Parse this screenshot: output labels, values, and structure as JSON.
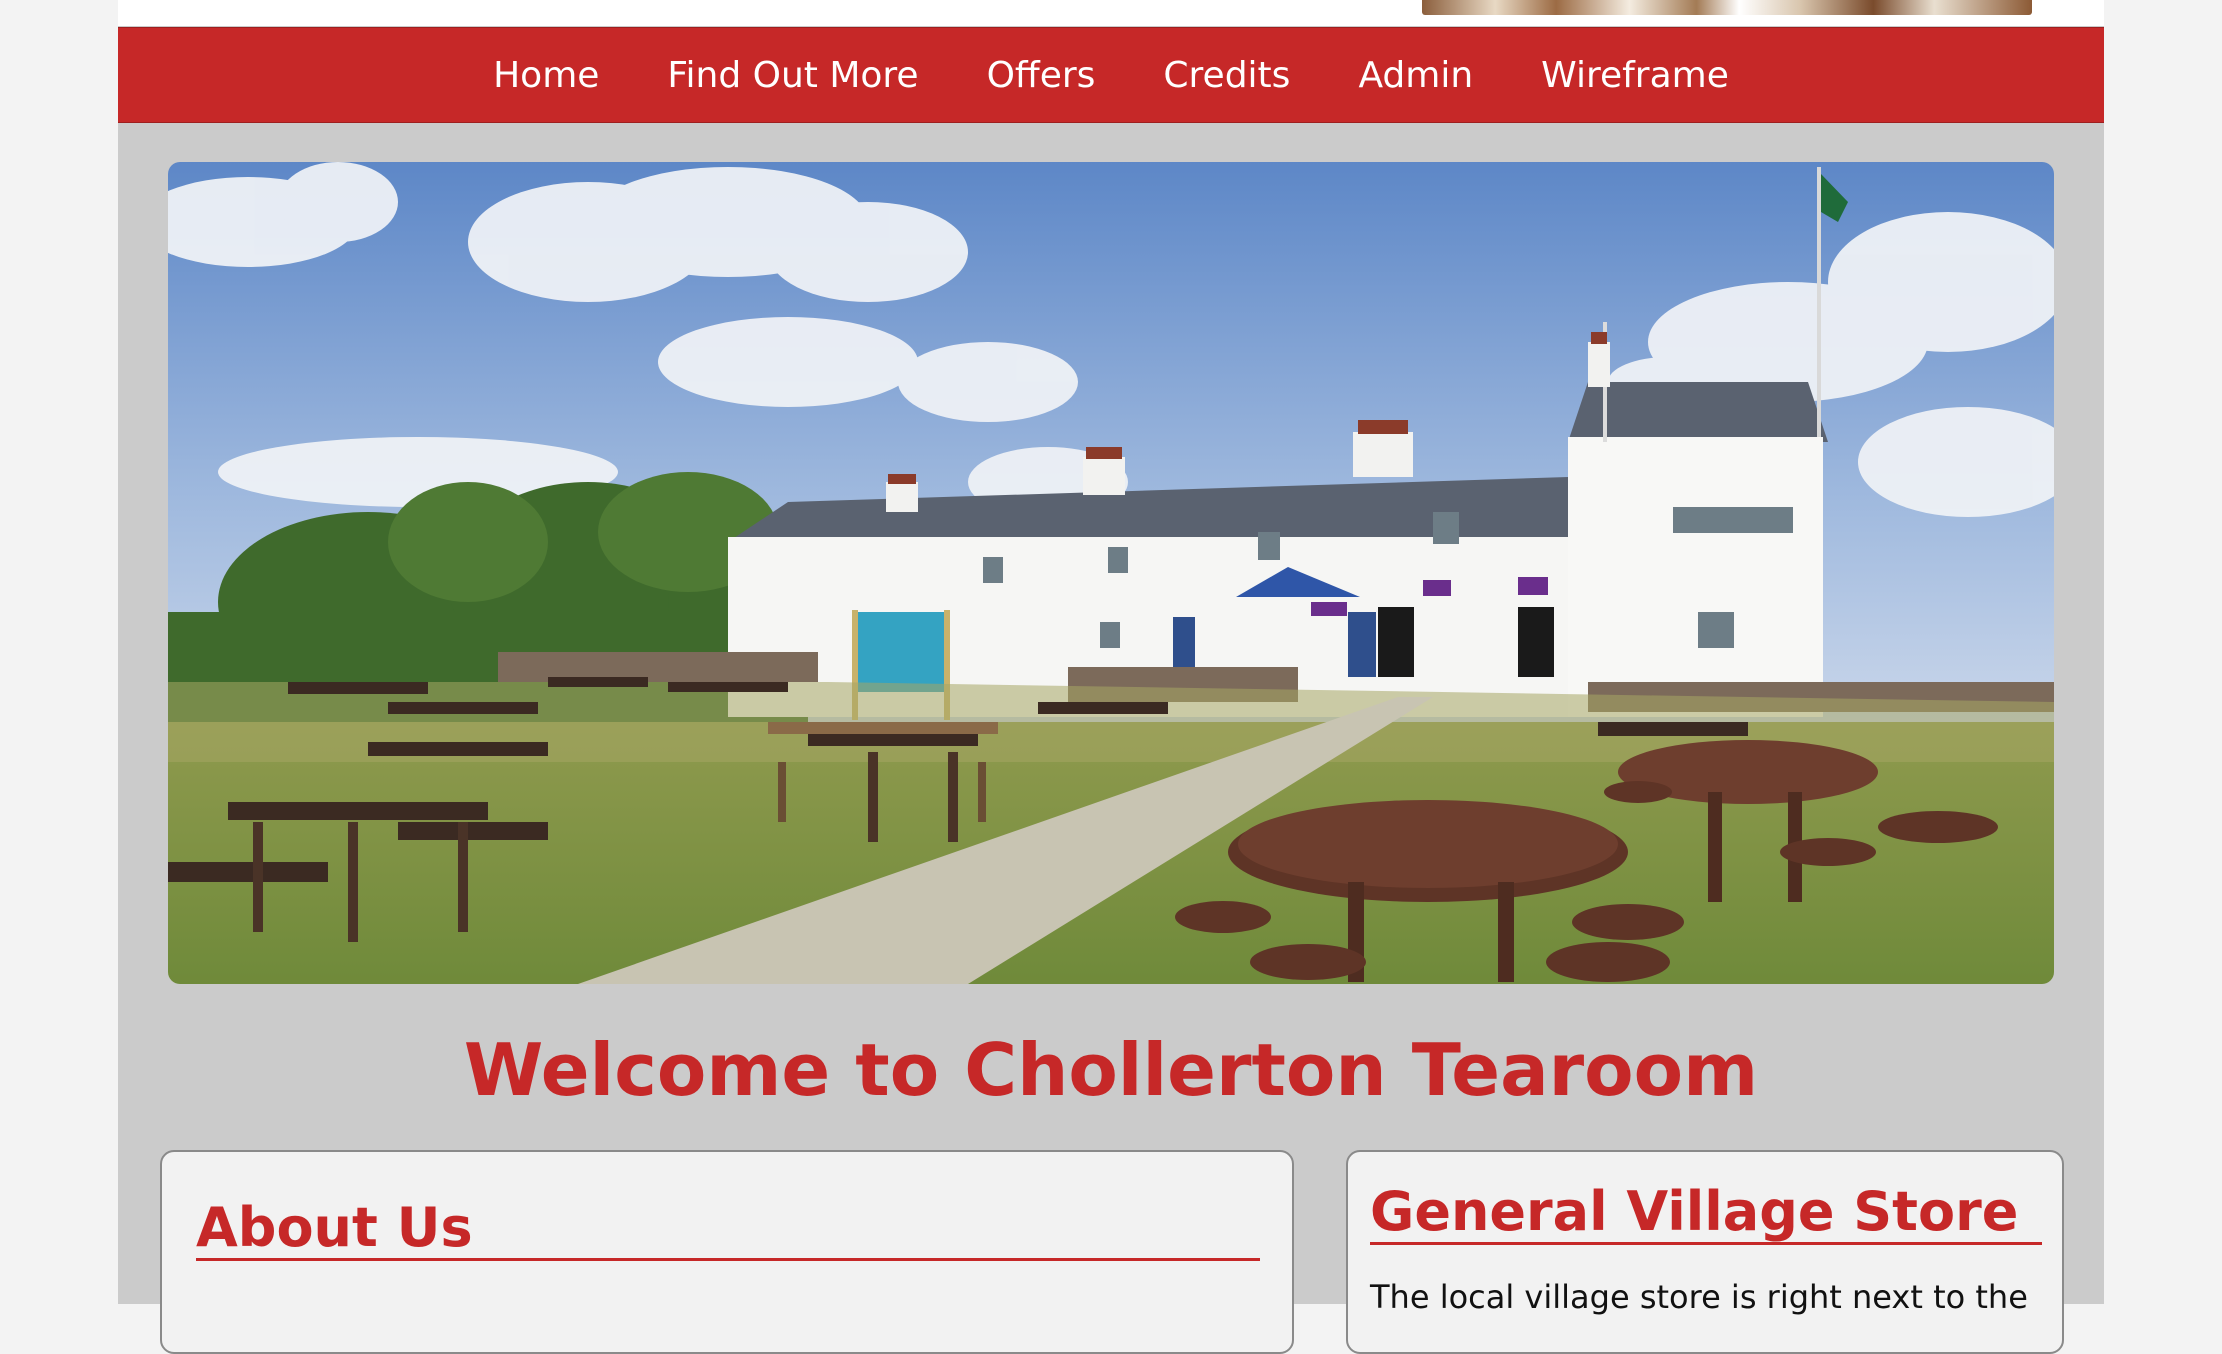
{
  "nav": {
    "items": [
      {
        "label": "Home"
      },
      {
        "label": "Find Out More"
      },
      {
        "label": "Offers"
      },
      {
        "label": "Credits"
      },
      {
        "label": "Admin"
      },
      {
        "label": "Wireframe"
      }
    ]
  },
  "hero": {
    "image": "tearoom-garden-photo"
  },
  "welcome": {
    "title": "Welcome to Chollerton Tearoom"
  },
  "about": {
    "heading": "About Us"
  },
  "store": {
    "heading": "General Village Store",
    "text": "The local village store is right next to the"
  },
  "colors": {
    "brand_red": "#c62828",
    "page_bg": "#cbcbcb",
    "outer_bg": "#f3f3f3"
  }
}
